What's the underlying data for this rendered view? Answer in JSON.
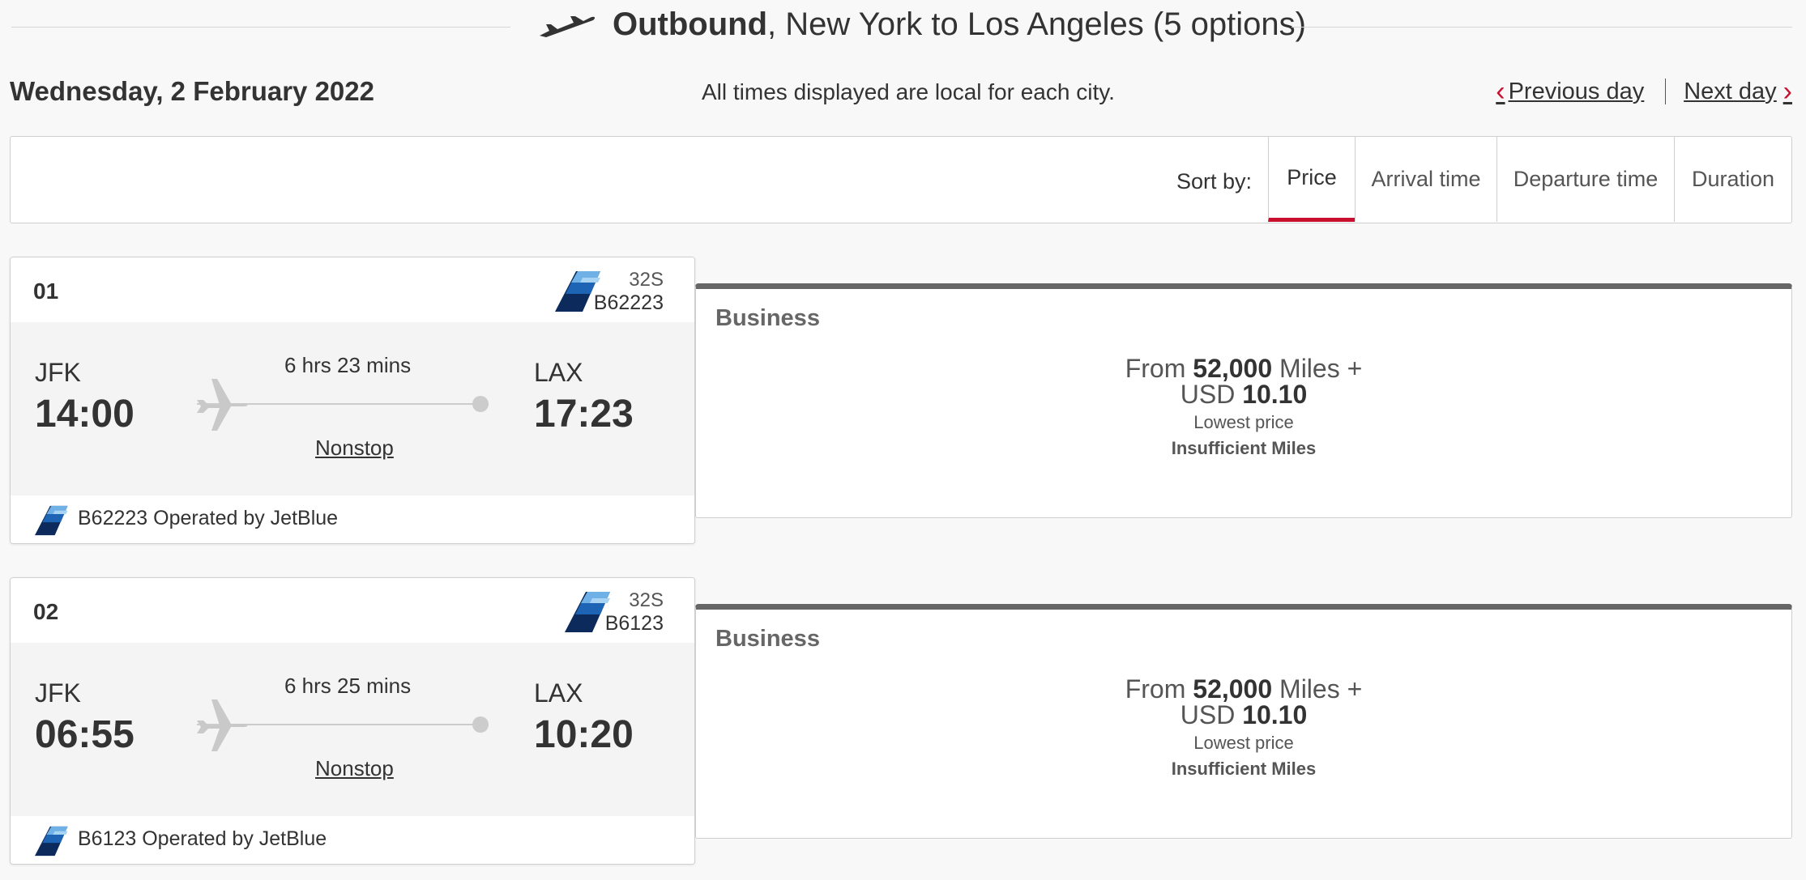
{
  "header": {
    "direction": "Outbound",
    "route": ", New York to Los Angeles (5 options)"
  },
  "date_row": {
    "date": "Wednesday, 2 February 2022",
    "note": "All times displayed are local for each city.",
    "previous_day": "Previous day",
    "next_day": "Next day"
  },
  "sort": {
    "label": "Sort by:",
    "options": [
      "Price",
      "Arrival time",
      "Departure time",
      "Duration"
    ],
    "active": "Price"
  },
  "colors": {
    "accent_red": "#c8102e",
    "jetblue_navy": "#0c2a5b",
    "jetblue_mid": "#1e64b4",
    "jetblue_light": "#6fb1e6"
  },
  "flights": [
    {
      "number": "01",
      "aircraft": "32S",
      "flight_no": "B62223",
      "origin": "JFK",
      "depart": "14:00",
      "duration": "6 hrs 23 mins",
      "stops": "Nonstop",
      "destination": "LAX",
      "arrive": "17:23",
      "operated": "B62223 Operated by JetBlue",
      "fare": {
        "cabin": "Business",
        "from": "From",
        "miles": "52,000",
        "miles_unit": "Miles +",
        "currency": "USD",
        "amount": "10.10",
        "lowest": "Lowest price",
        "status": "Insufficient Miles"
      }
    },
    {
      "number": "02",
      "aircraft": "32S",
      "flight_no": "B6123",
      "origin": "JFK",
      "depart": "06:55",
      "duration": "6 hrs 25 mins",
      "stops": "Nonstop",
      "destination": "LAX",
      "arrive": "10:20",
      "operated": "B6123 Operated by JetBlue",
      "fare": {
        "cabin": "Business",
        "from": "From",
        "miles": "52,000",
        "miles_unit": "Miles +",
        "currency": "USD",
        "amount": "10.10",
        "lowest": "Lowest price",
        "status": "Insufficient Miles"
      }
    }
  ]
}
